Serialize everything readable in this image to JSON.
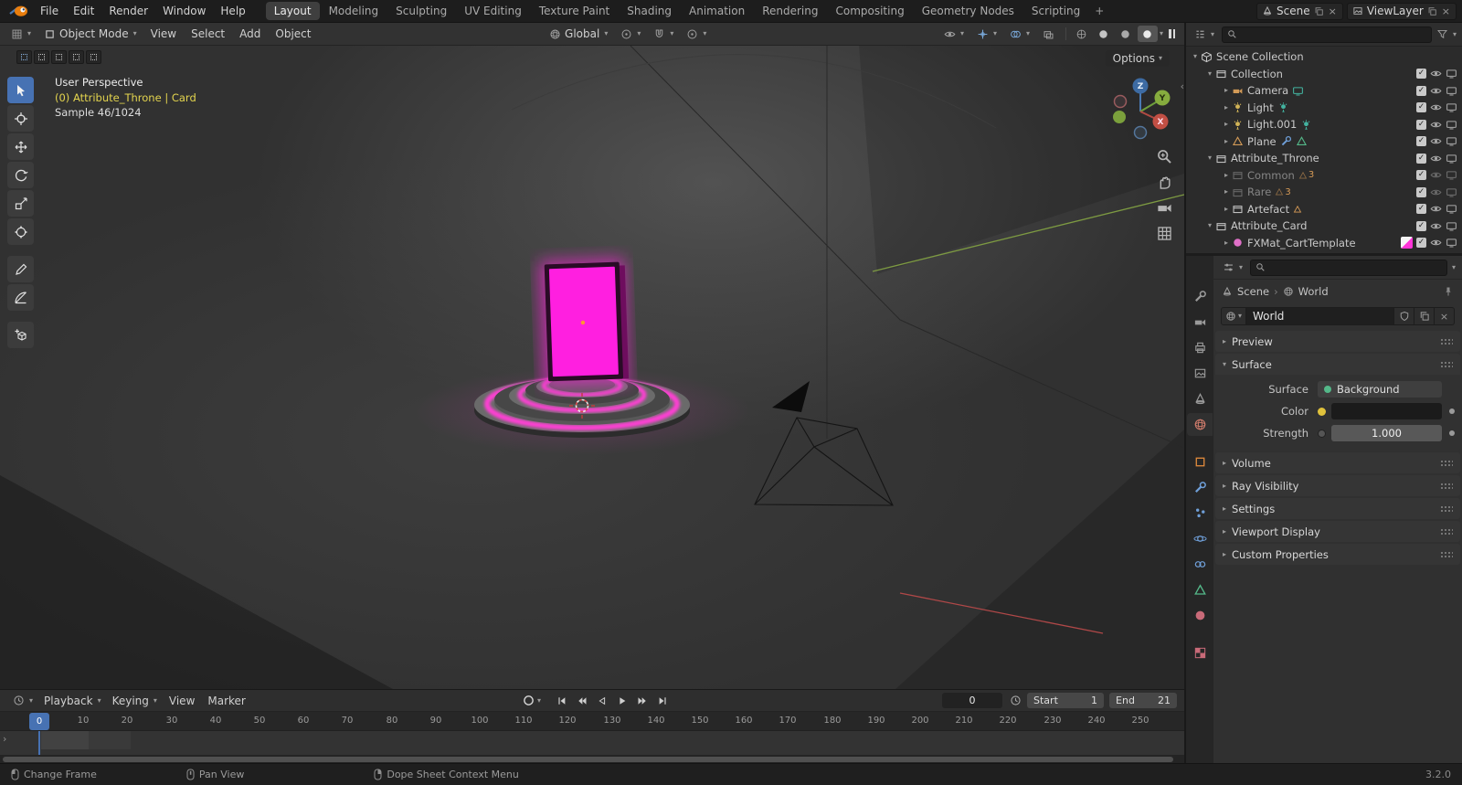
{
  "topbar": {
    "menus": [
      "File",
      "Edit",
      "Render",
      "Window",
      "Help"
    ],
    "tabs": [
      "Layout",
      "Modeling",
      "Sculpting",
      "UV Editing",
      "Texture Paint",
      "Shading",
      "Animation",
      "Rendering",
      "Compositing",
      "Geometry Nodes",
      "Scripting"
    ],
    "add_tab_label": "+",
    "scene_value": "Scene",
    "viewlayer_value": "ViewLayer"
  },
  "viewport": {
    "header": {
      "mode_value": "Object Mode",
      "menu_view": "View",
      "menu_select": "Select",
      "menu_add": "Add",
      "menu_object": "Object",
      "orientation_value": "Global",
      "options_label": "Options"
    },
    "overlay": {
      "line1": "User Perspective",
      "line2": "(0) Attribute_Throne | Card",
      "line3": "Sample 46/1024"
    },
    "gizmo": {
      "x": "X",
      "y": "Y",
      "z": "Z"
    }
  },
  "outliner": {
    "rows": [
      {
        "label": "Scene Collection"
      },
      {
        "label": "Collection"
      },
      {
        "label": "Camera"
      },
      {
        "label": "Light"
      },
      {
        "label": "Light.001"
      },
      {
        "label": "Plane"
      },
      {
        "label": "Attribute_Throne"
      },
      {
        "label": "Common",
        "badge": "3"
      },
      {
        "label": "Rare",
        "badge": "3"
      },
      {
        "label": "Artefact"
      },
      {
        "label": "Attribute_Card"
      },
      {
        "label": "FXMat_CartTemplate"
      }
    ]
  },
  "properties": {
    "breadcrumb": {
      "scene": "Scene",
      "world": "World"
    },
    "datablock_name": "World",
    "panels": {
      "preview": "Preview",
      "surface": "Surface",
      "volume": "Volume",
      "ray_visibility": "Ray Visibility",
      "settings": "Settings",
      "viewport_display": "Viewport Display",
      "custom_properties": "Custom Properties"
    },
    "surface": {
      "surface_label": "Surface",
      "surface_value": "Background",
      "color_label": "Color",
      "strength_label": "Strength",
      "strength_value": "1.000"
    }
  },
  "timeline": {
    "menu_playback": "Playback",
    "menu_keying": "Keying",
    "menu_view": "View",
    "menu_marker": "Marker",
    "frame_value": "0",
    "playhead_label": "0",
    "start_label": "Start",
    "start_value": "1",
    "end_label": "End",
    "end_value": "21",
    "ticks": [
      "0",
      "10",
      "20",
      "30",
      "40",
      "50",
      "60",
      "70",
      "80",
      "90",
      "100",
      "110",
      "120",
      "130",
      "140",
      "150",
      "160",
      "170",
      "180",
      "190",
      "200",
      "210",
      "220",
      "230",
      "240",
      "250"
    ]
  },
  "statusbar": {
    "hint_left": "Change Frame",
    "hint_middle": "Pan View",
    "hint_right": "Dope Sheet Context Menu",
    "version": "3.2.0"
  }
}
